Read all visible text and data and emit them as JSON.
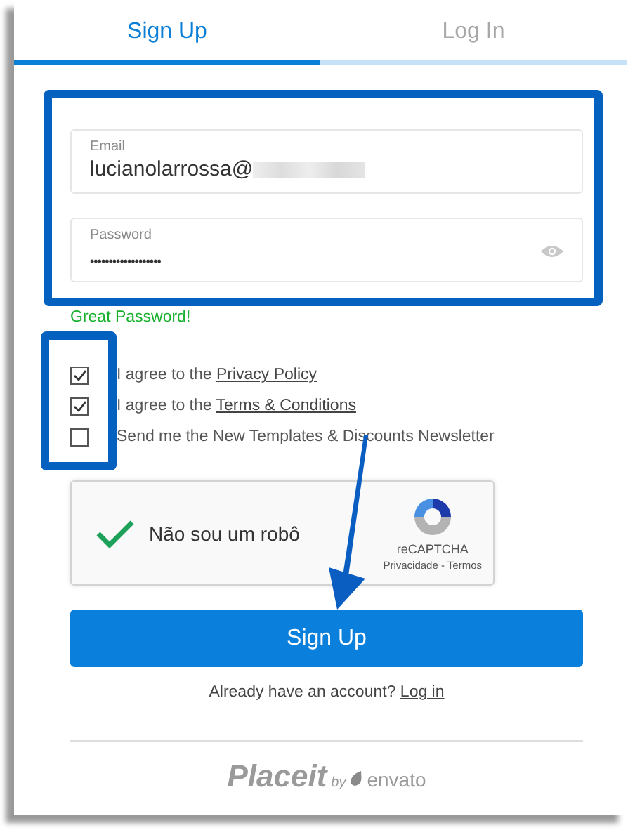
{
  "tabs": [
    {
      "label": "Sign Up",
      "selected": true
    },
    {
      "label": "Log In",
      "selected": false
    }
  ],
  "email": {
    "label": "Email",
    "value": "lucianolarrossa@"
  },
  "password": {
    "label": "Password",
    "value": "•••••••••••••••••••"
  },
  "password_feedback": "Great Password!",
  "checkboxes": [
    {
      "text": "I agree to the ",
      "link": "Privacy Policy",
      "checked": true
    },
    {
      "text": "I agree to the ",
      "link": "Terms & Conditions",
      "checked": true
    },
    {
      "text": "Send me the New Templates & Discounts Newsletter",
      "checked": false
    }
  ],
  "recaptcha": {
    "label": "Não sou um robô",
    "checked": true,
    "brand": "reCAPTCHA",
    "links": "Privacidade - Termos"
  },
  "submit": "Sign Up",
  "login_prompt": {
    "text": "Already have an account?",
    "link": "Log in"
  },
  "logo": {
    "name": "Placeit",
    "by": "by",
    "brand": "envato"
  }
}
